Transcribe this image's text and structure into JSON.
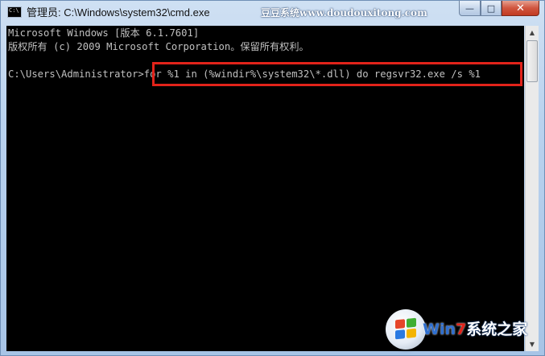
{
  "window": {
    "title": "管理员: C:\\Windows\\system32\\cmd.exe",
    "icon_label": "C:\\",
    "watermark_top": "豆豆系统www.doudouxitong.com",
    "buttons": {
      "minimize": "—",
      "maximize": "□",
      "close": "✕"
    }
  },
  "console": {
    "lines": [
      "Microsoft Windows [版本 6.1.7601]",
      "版权所有 (c) 2009 Microsoft Corporation。保留所有权利。",
      "",
      "C:\\Users\\Administrator>for %1 in (%windir%\\system32\\*.dll) do regsvr32.exe /s %1"
    ]
  },
  "scrollbar": {
    "up": "▲",
    "down": "▼"
  },
  "watermark_bottom": {
    "part1": "Win",
    "part2": "7",
    "part3": "系统之家"
  },
  "colors": {
    "console_bg": "#000000",
    "console_text": "#c0c0c0",
    "highlight": "#e2231a",
    "flag_red": "#e6462a",
    "flag_green": "#3fae32",
    "flag_blue": "#2a7ae2",
    "flag_yellow": "#f4b400"
  }
}
